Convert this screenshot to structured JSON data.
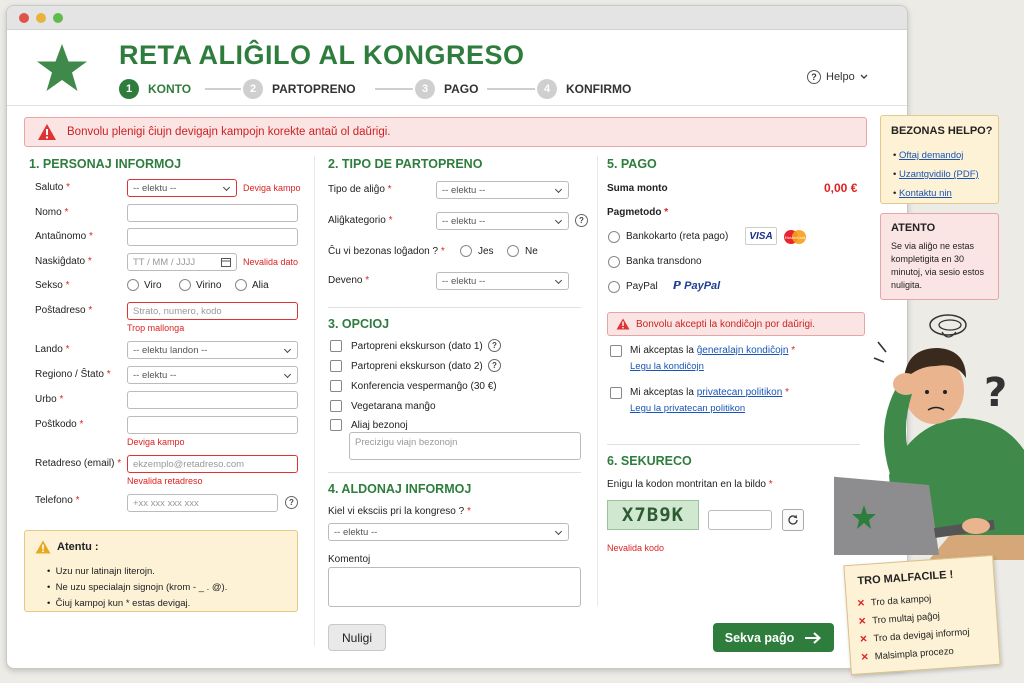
{
  "header": {
    "title": "RETA ALIĜILO AL KONGRESO",
    "steps": [
      {
        "num": "1",
        "label": "KONTO"
      },
      {
        "num": "2",
        "label": "PARTOPRENO"
      },
      {
        "num": "3",
        "label": "PAGO"
      },
      {
        "num": "4",
        "label": "KONFIRMO"
      }
    ],
    "help_label": "Helpo",
    "help_icon": "?"
  },
  "error_banner": "Bonvolu plenigi ĉiujn devigajn kampojn korekte antaŭ ol daŭrigi.",
  "personal": {
    "heading": "1. PERSONAJ INFORMOJ",
    "salutation": {
      "label": "Saluto",
      "value": "-- elektu --",
      "error": "Deviga kampo"
    },
    "name_label": "Nomo",
    "surname_label": "Antaŭnomo",
    "birth": {
      "label": "Naskiĝdato",
      "placeholder": "TT / MM / JJJJ",
      "error": "Nevalida dato"
    },
    "sex": {
      "label": "Sekso",
      "options": [
        "Viro",
        "Virino",
        "Alia"
      ]
    },
    "address": {
      "label": "Poŝtadreso",
      "placeholder": "Strato, numero, kodo",
      "error": "Trop mallonga"
    },
    "country": {
      "label": "Lando",
      "value": "-- elektu landon --"
    },
    "region": {
      "label": "Regiono / Ŝtato",
      "value": "-- elektu --"
    },
    "city_label": "Urbo",
    "postcode": {
      "label": "Poŝtkodo",
      "error": "Deviga kampo"
    },
    "email": {
      "label": "Retadreso (email)",
      "placeholder": "ekzemplo@retadreso.com",
      "error": "Nevalida retadreso"
    },
    "phone": {
      "label": "Telefono",
      "placeholder": "+xx xxx xxx xxx"
    }
  },
  "attention": {
    "title": "Atentu :",
    "items": [
      "Uzu nur latinajn literojn.",
      "Ne uzu specialajn signojn (krom - _ . @).",
      "Ĉiuj kampoj kun * estas devigaj."
    ]
  },
  "participation": {
    "heading": "2. TIPO DE PARTOPRENO",
    "type": {
      "label": "Tipo de aliĝo",
      "value": "-- elektu --"
    },
    "category": {
      "label": "Aliĝkategorio",
      "value": "-- elektu --"
    },
    "lodging": {
      "label": "Ĉu vi bezonas loĝadon ?",
      "options": [
        "Jes",
        "Ne"
      ]
    },
    "currency": {
      "label": "Deveno",
      "value": "-- elektu --"
    }
  },
  "options": {
    "heading": "3. OPCIOJ",
    "items": [
      "Partopreni ekskurson (dato 1)",
      "Partopreni ekskurson (dato 2)",
      "Konferencia vespermanĝo (30 €)",
      "Vegetarana manĝo",
      "Aliaj bezonoj"
    ],
    "needs_placeholder": "Precizigu viajn bezonojn"
  },
  "additional": {
    "heading": "4. ALDONAJ INFORMOJ",
    "source": {
      "label": "Kiel vi eksciis pri la kongreso ?",
      "value": "-- elektu --"
    },
    "comment_label": "Komentoj"
  },
  "payment": {
    "heading": "5. PAGO",
    "sum_label": "Suma monto",
    "sum_value": "0,00 €",
    "method_label": "Pagmetodo",
    "methods": [
      "Bankokarto (reta pago)",
      "Banka transdono",
      "PayPal"
    ],
    "visa": "VISA",
    "mastercard": "MasterCard",
    "paypal": "PayPal",
    "terms_error": "Bonvolu akcepti la kondiĉojn por daŭrigi.",
    "terms_prefix": "Mi akceptas la",
    "terms_link": "ĝeneralajn kondiĉojn",
    "terms_read": "Legu la kondiĉojn",
    "privacy_prefix": "Mi akceptas la",
    "privacy_link": "privatecan politikon",
    "privacy_read": "Legu la privatecan politikon"
  },
  "security": {
    "heading": "6. SEKURECO",
    "label": "Enigu la kodon montritan en la bildo",
    "captcha": "X7B9K",
    "error": "Nevalida kodo"
  },
  "buttons": {
    "cancel": "Nuligi",
    "next": "Sekva paĝo"
  },
  "side_help": {
    "title": "BEZONAS HELPO?",
    "links": [
      "Oftaj demandoj",
      "Uzantgvidilo (PDF)",
      "Kontaktu nin"
    ]
  },
  "side_warn": {
    "title": "ATENTO",
    "text": "Se via aliĝo ne estas kompletigita en 30 minutoj, via sesio estos nuligita."
  },
  "sticky": {
    "title": "TRO MALFACILE !",
    "items": [
      "Tro da kampoj",
      "Tro multaj paĝoj",
      "Tro da devigaj informoj",
      "Malsimpla procezo"
    ]
  },
  "colors": {
    "brand": "#2e7d3d",
    "error": "#dd2222",
    "note": "#fdf2d6"
  }
}
